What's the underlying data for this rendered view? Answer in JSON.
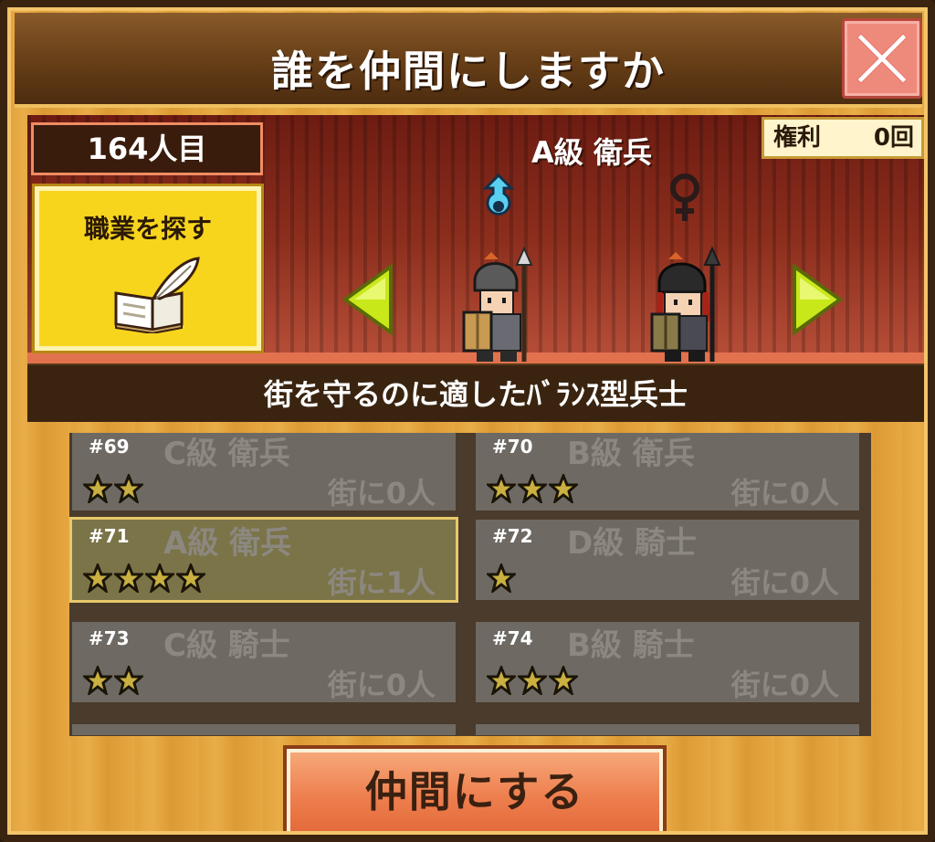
{
  "dialog": {
    "title": "誰を仲間にしますか",
    "close_icon": "close-x-icon"
  },
  "stage": {
    "count_label": "164人目",
    "job_search_label": "職業を探す",
    "class_name": "A級 衛兵",
    "rights_label": "権利",
    "rights_value": "0回",
    "description": "街を守るのに適したﾊﾞﾗﾝｽ型兵士",
    "characters": [
      {
        "gender": "male",
        "gender_icon": "male-symbol-icon"
      },
      {
        "gender": "female",
        "gender_icon": "female-symbol-icon"
      }
    ]
  },
  "list": [
    {
      "num": "#69",
      "cls": "C級 衛兵",
      "stars": 2,
      "town": "街に0人",
      "selected": false
    },
    {
      "num": "#70",
      "cls": "B級 衛兵",
      "stars": 3,
      "town": "街に0人",
      "selected": false
    },
    {
      "num": "#71",
      "cls": "A級 衛兵",
      "stars": 4,
      "town": "街に1人",
      "selected": true
    },
    {
      "num": "#72",
      "cls": "D級 騎士",
      "stars": 1,
      "town": "街に0人",
      "selected": false
    },
    {
      "num": "#73",
      "cls": "C級 騎士",
      "stars": 2,
      "town": "街に0人",
      "selected": false
    },
    {
      "num": "#74",
      "cls": "B級 騎士",
      "stars": 3,
      "town": "街に0人",
      "selected": false
    }
  ],
  "recruit_button": "仲間にする",
  "colors": {
    "stage_red": "#8c2e1d",
    "job_search_yellow": "#f7d51d",
    "recruit_orange": "#ee7f4f",
    "close_red": "#ee8a7c"
  }
}
